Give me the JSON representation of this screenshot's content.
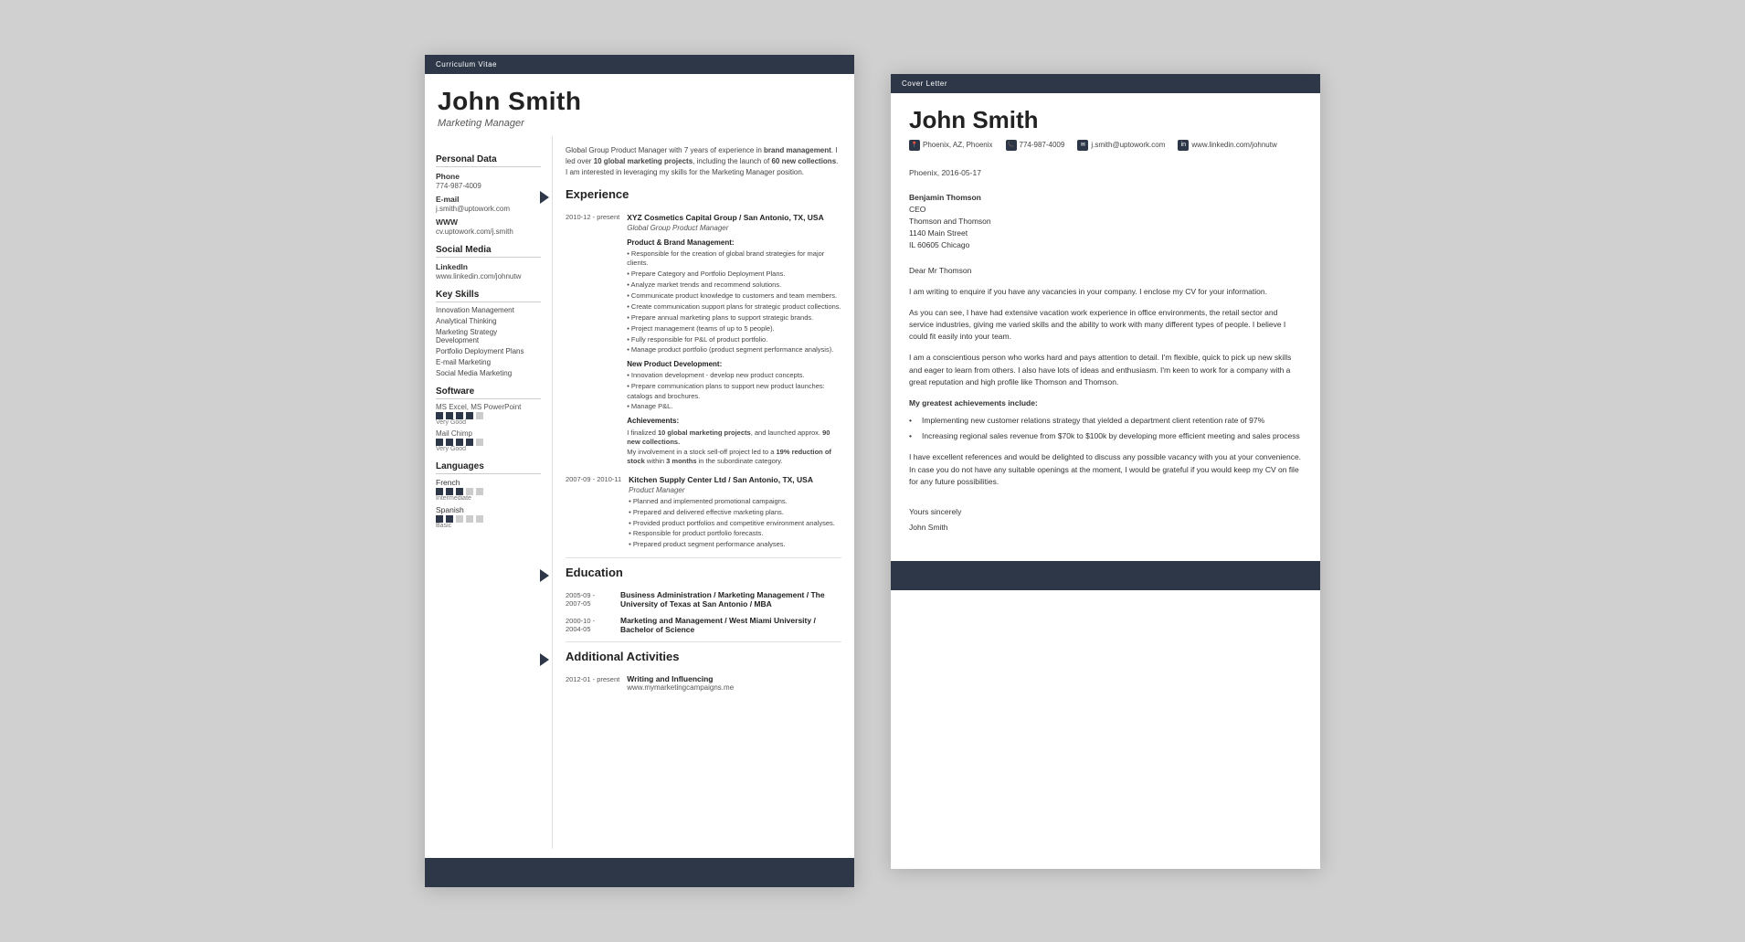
{
  "cv": {
    "header_label": "Curriculum Vitae",
    "name": "John Smith",
    "title": "Marketing Manager",
    "summary": "Global Group Product Manager with 7 years of experience in brand management. I led over 10 global marketing projects, including the launch of 60 new collections. I am interested in leveraging my skills for the Marketing Manager position.",
    "sidebar": {
      "personal_data_label": "Personal Data",
      "phone_label": "Phone",
      "phone_value": "774-987-4009",
      "email_label": "E-mail",
      "email_value": "j.smith@uptowork.com",
      "www_label": "WWW",
      "www_value": "cv.uptowork.com/j.smith",
      "social_media_label": "Social Media",
      "linkedin_label": "LinkedIn",
      "linkedin_value": "www.linkedin.com/johnutw",
      "key_skills_label": "Key Skills",
      "skills": [
        "Innovation Management",
        "Analytical Thinking",
        "Marketing Strategy Development",
        "Portfolio Deployment Plans",
        "E-mail Marketing",
        "Social Media Marketing"
      ],
      "software_label": "Software",
      "software_items": [
        {
          "name": "MS Excel, MS PowerPoint",
          "level": "Very Good",
          "dots": 4
        },
        {
          "name": "Mail Chimp",
          "level": "Very Good",
          "dots": 4
        }
      ],
      "languages_label": "Languages",
      "language_items": [
        {
          "name": "French",
          "level": "Intermediate",
          "dots": 3
        },
        {
          "name": "Spanish",
          "level": "Basic",
          "dots": 2
        }
      ]
    },
    "experience_label": "Experience",
    "experience": [
      {
        "date": "2010-12 - present",
        "company": "XYZ Cosmetics Capital Group / San Antonio, TX, USA",
        "role": "Global Group Product Manager",
        "sections": [
          {
            "heading": "Product & Brand Management:",
            "bullets": [
              "Responsible for the creation of global brand strategies for major clients.",
              "Prepare Category and Portfolio Deployment Plans.",
              "Analyze market trends and recommend solutions.",
              "Communicate product knowledge to customers and team members.",
              "Create communication support plans for strategic product collections.",
              "Prepare annual marketing plans to support strategic brands.",
              "Project management (teams of up to 5 people).",
              "Fully responsible for P&L of product portfolio.",
              "Manage product portfolio (product segment performance analysis)."
            ]
          },
          {
            "heading": "New Product Development:",
            "bullets": [
              "Innovation development - develop new product concepts.",
              "Prepare communication plans to support new product launches: catalogs and brochures.",
              "Manage P&L."
            ]
          },
          {
            "heading": "Achievements:",
            "achievement": "I finalized 10 global marketing projects, and launched approx. 90 new collections.\nMy involvement in a stock sell-off project led to a 19% reduction of stock within 3 months in the subordinate category."
          }
        ]
      },
      {
        "date": "2007-09 - 2010-11",
        "company": "Kitchen Supply Center Ltd / San Antonio, TX, USA",
        "role": "Product Manager",
        "bullets": [
          "Planned and implemented promotional campaigns.",
          "Prepared and delivered effective marketing plans.",
          "Provided product portfolios and competitive environment analyses.",
          "Responsible for product portfolio forecasts.",
          "Prepared product segment performance analyses."
        ]
      }
    ],
    "education_label": "Education",
    "education": [
      {
        "date": "2005-09 - 2007-05",
        "degree": "Business Administration / Marketing Management / The University of Texas at San Antonio / MBA"
      },
      {
        "date": "2000-10 - 2004-05",
        "degree": "Marketing and Management / West Miami University / Bachelor of Science"
      }
    ],
    "activities_label": "Additional Activities",
    "activities": [
      {
        "date": "2012-01 - present",
        "title": "Writing and Influencing",
        "detail": "www.mymarketingcampaigns.me"
      }
    ]
  },
  "cover_letter": {
    "header_label": "Cover Letter",
    "name": "John Smith",
    "contact": {
      "location": "Phoenix, AZ, Phoenix",
      "phone": "774-987-4009",
      "email": "j.smith@uptowork.com",
      "linkedin": "www.linkedin.com/johnutw"
    },
    "date": "Phoenix, 2016-05-17",
    "recipient": {
      "name": "Benjamin Thomson",
      "title": "CEO",
      "company": "Thomson and Thomson",
      "address": "1140 Main Street",
      "city": "IL 60605 Chicago"
    },
    "greeting": "Dear Mr Thomson",
    "paragraphs": [
      "I am writing to enquire if you have any vacancies in your company. I enclose my CV for your information.",
      "As you can see, I have had extensive vacation work experience in office environments, the retail sector and service industries, giving me varied skills and the ability to work with many different types of people. I believe I could fit easily into your team.",
      "I am a conscientious person who works hard and pays attention to detail. I'm flexible, quick to pick up new skills and eager to learn from others. I also have lots of ideas and enthusiasm. I'm keen to work for a company with a great reputation and high profile like Thomson and Thomson."
    ],
    "achievements_heading": "My greatest achievements include:",
    "achievements": [
      "Implementing new customer relations strategy that yielded a department client retention rate of 97%",
      "Increasing regional sales revenue from $70k to $100k by developing more efficient meeting and sales process"
    ],
    "closing_para": "I have excellent references and would be delighted to discuss any possible vacancy with you at your convenience. In case you do not have any suitable openings at the moment, I would be grateful if you would keep my CV on file for any future possibilities.",
    "sign_off": "Yours sincerely",
    "signature": "John Smith"
  }
}
